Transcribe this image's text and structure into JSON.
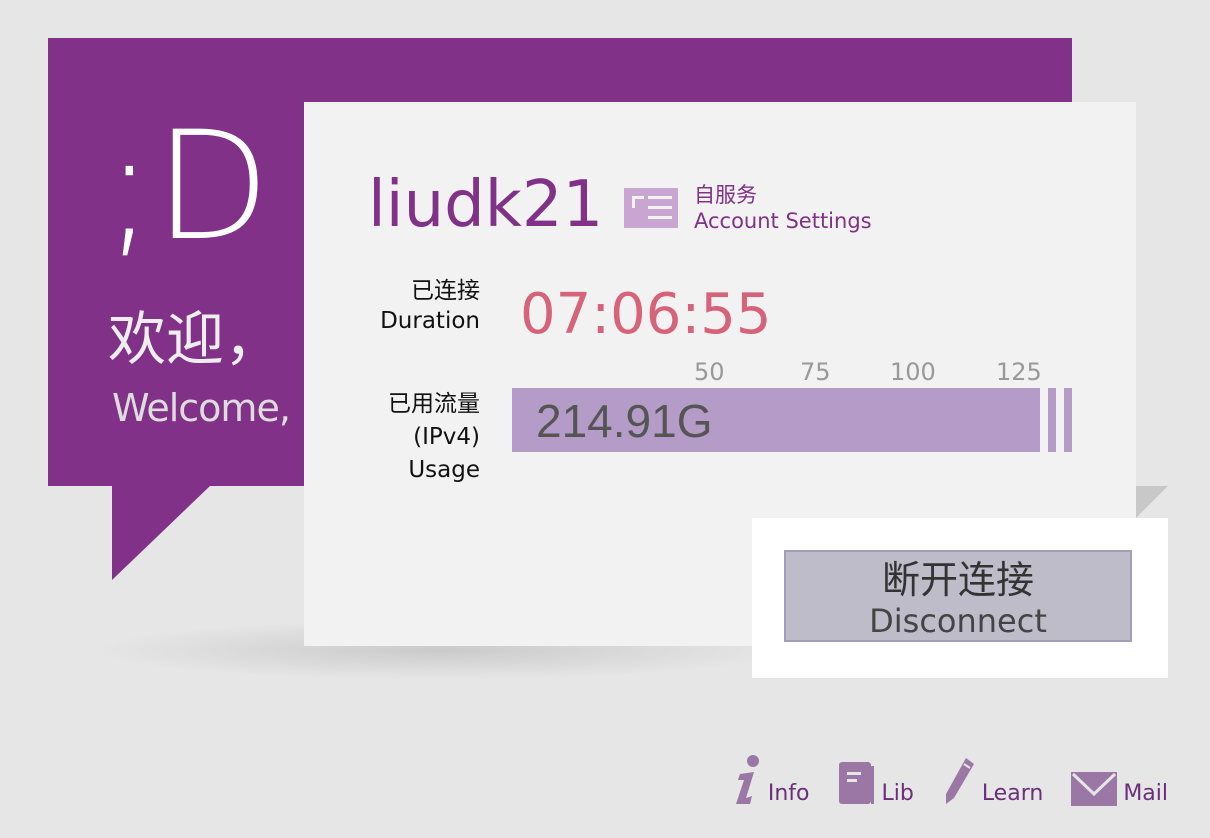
{
  "welcome": {
    "smiley": ";D",
    "greeting_cn": "欢迎，",
    "greeting_en": "Welcome,"
  },
  "user": {
    "name": "liudk21"
  },
  "account_settings": {
    "label_cn": "自服务",
    "label_en": "Account Settings",
    "icon": "id-card-icon"
  },
  "duration": {
    "label_cn": "已连接",
    "label_en": "Duration",
    "value": "07:06:55"
  },
  "usage": {
    "label_cn": "已用流量",
    "label_proto": "(IPv4)",
    "label_en": "Usage",
    "value": "214.91G",
    "ticks": [
      "50",
      "75",
      "100",
      "125"
    ],
    "bar_fill_percent": 100
  },
  "disconnect": {
    "label_cn": "断开连接",
    "label_en": "Disconnect"
  },
  "footer": [
    {
      "label": "Info",
      "icon": "info-icon"
    },
    {
      "label": "Lib",
      "icon": "book-icon"
    },
    {
      "label": "Learn",
      "icon": "pencil-icon"
    },
    {
      "label": "Mail",
      "icon": "mail-icon"
    }
  ],
  "colors": {
    "brand": "#813187",
    "duration": "#d6637a",
    "bar": "#b59bc7"
  }
}
